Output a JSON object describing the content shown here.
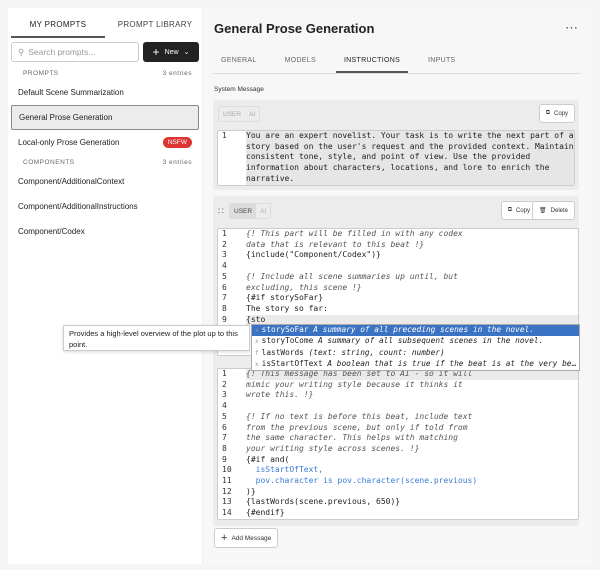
{
  "sidebar": {
    "tabs": [
      "MY PROMPTS",
      "PROMPT LIBRARY"
    ],
    "search_placeholder": "Search prompts...",
    "new_label": "New",
    "prompts_header": "PROMPTS",
    "prompts_count": "3 entries",
    "prompts": [
      {
        "label": "Default Scene Summarization"
      },
      {
        "label": "General Prose Generation",
        "selected": true
      },
      {
        "label": "Local-only Prose Generation",
        "badge": "NSFW"
      }
    ],
    "components_header": "COMPONENTS",
    "components_count": "3 entries",
    "components": [
      "Component/AdditionalContext",
      "Component/AdditionalInstructions",
      "Component/Codex"
    ]
  },
  "main": {
    "title": "General Prose Generation",
    "tabs": [
      "GENERAL",
      "MODELS",
      "INSTRUCTIONS",
      "INPUTS"
    ],
    "active_tab": "INSTRUCTIONS",
    "system_label": "System Message",
    "role_user": "USER",
    "role_ai": "AI",
    "copy_label": "Copy",
    "delete_label": "Delete",
    "add_message_label": "Add Message",
    "system_text": [
      "You are an expert novelist. Your task is to write the next part of a",
      "story based on the user's request and the provided context. Maintain a",
      "consistent tone, style, and point of view. Use the provided",
      "information about characters, locations, and lore to enrich the",
      "narrative."
    ],
    "user_lines": [
      "{! This part will be filled in with any codex",
      "data that is relevant to this beat !}",
      "{include(\"Component/Codex\")}",
      "",
      "{! Include all scene summaries up until, but",
      "excluding, this scene !}",
      "{#if storySoFar}",
      "The story so far:",
      "{sto"
    ],
    "ai_lines": [
      "{! This message has been set to AI - so it will",
      "mimic your writing style because it thinks it",
      "wrote this. !}",
      "",
      "{! If no text is before this beat, include text",
      "from the previous scene, but only if told from",
      "the same character. This helps with matching",
      "your writing style across scenes. !}",
      "{#if and(",
      "  isStartOfText,",
      "  pov.character is pov.character(scene.previous)",
      ")}",
      "{lastWords(scene.previous, 650)}",
      "{#endif}"
    ],
    "autocomplete": [
      {
        "kind": "x",
        "name": "storySoFar",
        "desc": "A summary of all preceding scenes in the novel."
      },
      {
        "kind": "x",
        "name": "storyToCome",
        "desc": "A summary of all subsequent scenes in the novel."
      },
      {
        "kind": "f",
        "name": "lastWords",
        "desc": "(text: string, count: number)"
      },
      {
        "kind": "x",
        "name": "isStartOfText",
        "desc": "A boolean that is true if the beat is at the very beginning"
      }
    ],
    "tooltip": "Provides a high-level overview of the plot up to this point."
  },
  "colors": {
    "accent": "#3b73c4",
    "nsfw": "#dd3333",
    "keyword": "#3a7bd5",
    "string": "#d9643a"
  }
}
